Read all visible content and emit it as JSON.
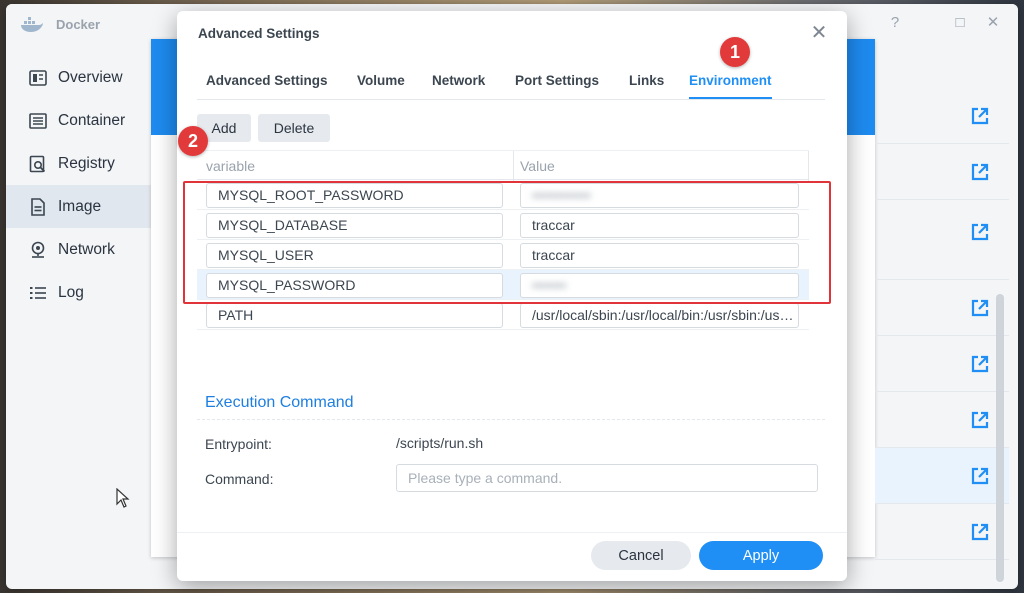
{
  "app": {
    "title": "Docker",
    "window_controls": [
      "?",
      "□",
      "✕"
    ]
  },
  "sidebar": {
    "items": [
      {
        "label": "Overview",
        "icon": "overview-icon",
        "active": false
      },
      {
        "label": "Container",
        "icon": "container-icon",
        "active": false
      },
      {
        "label": "Registry",
        "icon": "registry-icon",
        "active": false
      },
      {
        "label": "Image",
        "icon": "image-icon",
        "active": true
      },
      {
        "label": "Network",
        "icon": "network-icon",
        "active": false
      },
      {
        "label": "Log",
        "icon": "log-icon",
        "active": false
      }
    ]
  },
  "dialog": {
    "title": "Advanced Settings",
    "close": "✕",
    "tabs": [
      {
        "label": "Advanced Settings",
        "active": false
      },
      {
        "label": "Volume",
        "active": false
      },
      {
        "label": "Network",
        "active": false
      },
      {
        "label": "Port Settings",
        "active": false
      },
      {
        "label": "Links",
        "active": false
      },
      {
        "label": "Environment",
        "active": true
      }
    ],
    "toolbar": {
      "add_label": "Add",
      "delete_label": "Delete"
    },
    "env_table": {
      "headers": [
        "variable",
        "Value"
      ],
      "rows": [
        {
          "variable": "MYSQL_ROOT_PASSWORD",
          "value": "••••••••••••",
          "blurred": true
        },
        {
          "variable": "MYSQL_DATABASE",
          "value": "traccar",
          "blurred": false
        },
        {
          "variable": "MYSQL_USER",
          "value": "traccar",
          "blurred": false
        },
        {
          "variable": "MYSQL_PASSWORD",
          "value": "•••••••",
          "blurred": true
        },
        {
          "variable": "PATH",
          "value": "/usr/local/sbin:/usr/local/bin:/usr/sbin:/usr/bin:/sbin:/bin",
          "blurred": false
        }
      ]
    },
    "execution": {
      "title": "Execution Command",
      "entrypoint_label": "Entrypoint:",
      "entrypoint_value": "/scripts/run.sh",
      "command_label": "Command:",
      "command_value": "",
      "command_placeholder": "Please type a command."
    },
    "footer": {
      "cancel_label": "Cancel",
      "apply_label": "Apply"
    }
  },
  "annotations": {
    "badge_1": "1",
    "badge_2": "2"
  },
  "colors": {
    "accent": "#1f8ff5",
    "highlight_box": "#e0333a",
    "badge": "#e23a3a"
  }
}
